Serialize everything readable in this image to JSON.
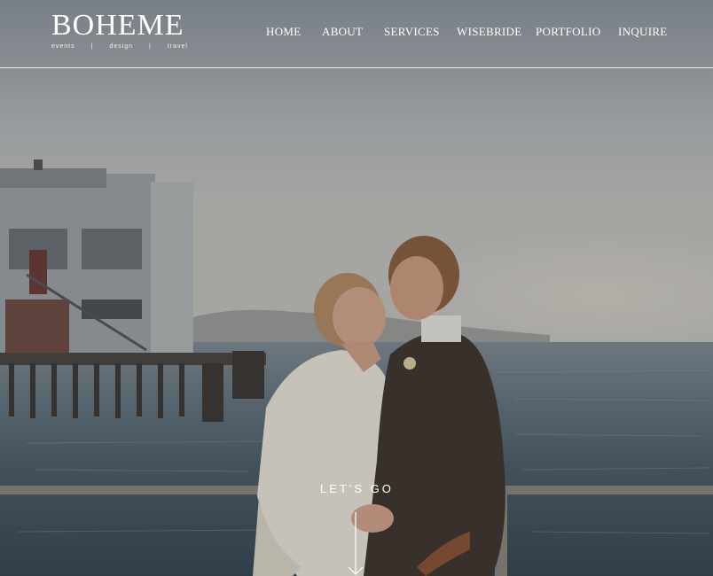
{
  "brand": {
    "name": "BOHEME",
    "tagline": [
      "events",
      "|",
      "design",
      "|",
      "travel"
    ]
  },
  "nav": {
    "items": [
      "HOME",
      "ABOUT",
      "SERVICES",
      "WISEBRIDE",
      "PORTFOLIO",
      "INQUIRE"
    ]
  },
  "hero": {
    "cta_label": "LET'S GO"
  },
  "colors": {
    "header_text": "#ffffff",
    "header_rule": "#ffffff"
  }
}
